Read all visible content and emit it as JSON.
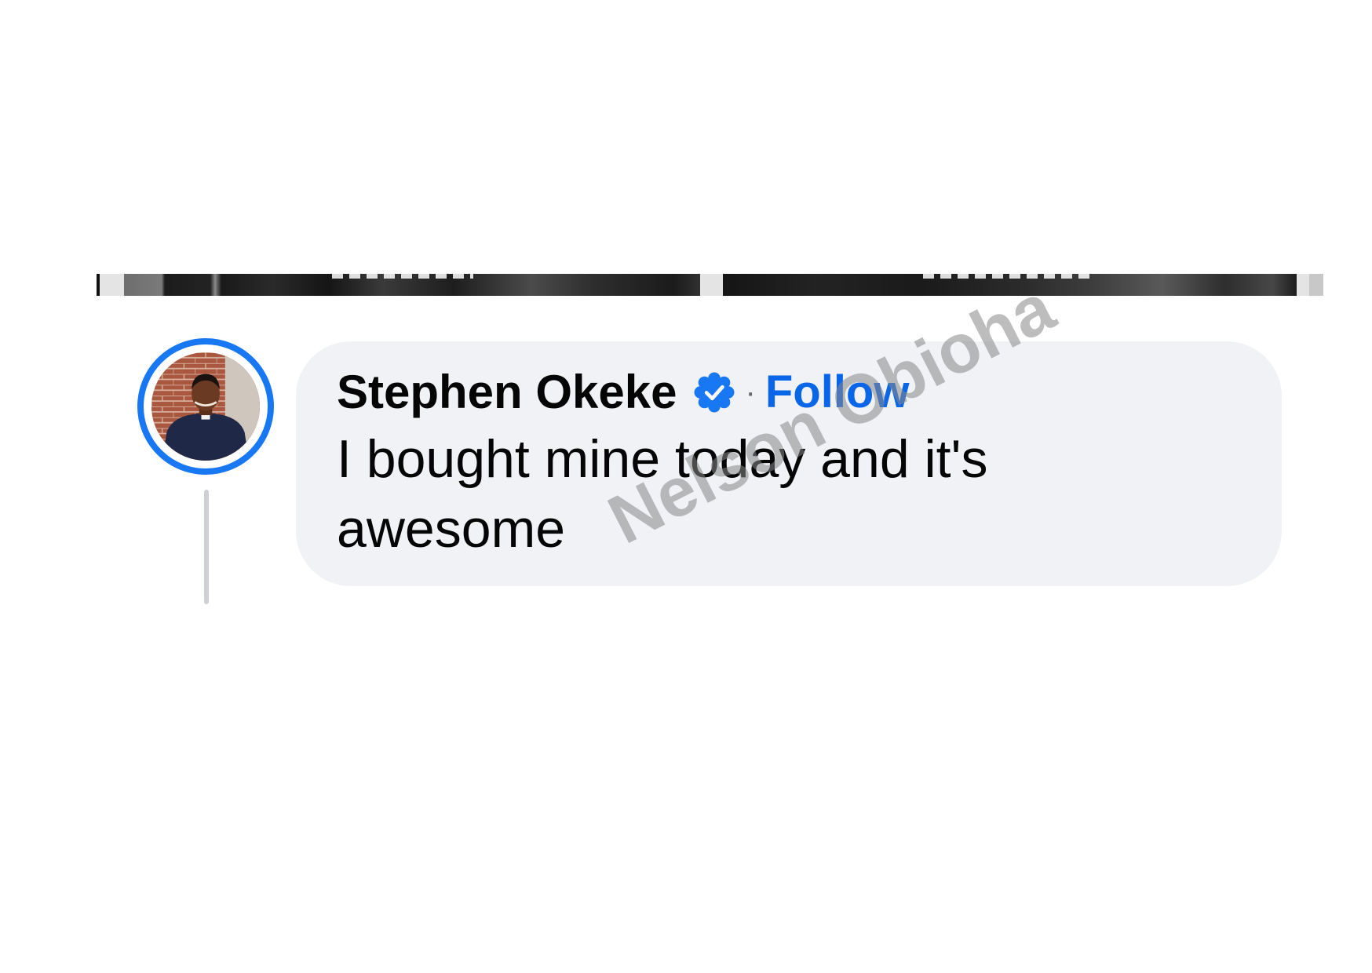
{
  "comment": {
    "author_name": "Stephen Okeke",
    "verified_icon": "verified-badge-icon",
    "separator": "·",
    "follow_label": "Follow",
    "text": "I bought mine today and it's awesome"
  },
  "avatar": {
    "icon": "profile-photo"
  },
  "watermark": {
    "text": "Nelson Obioha"
  },
  "colors": {
    "bubble": "#f0f2f5",
    "follow": "#0a66e8",
    "ring": "#1877f2",
    "badge": "#1877f2",
    "thread": "#ced0d4"
  }
}
